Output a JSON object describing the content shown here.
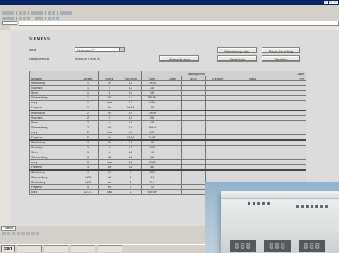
{
  "sheet": {
    "title": "SIEMENS",
    "gerat_label": "Gerät",
    "gerat_value": "Multimeter DO",
    "fabrik_label": "Fabrik Lieferung",
    "fabrik_value": "00000000 0 0000 00",
    "buttons": {
      "messwerte": "Messwerte lesen",
      "balkenanzeige": "Balkenanzeige laden",
      "starte_lesen": "Starte Lesen",
      "display": "Display Darstellung",
      "starte_neu": "Starte Neu"
    },
    "headers": {
      "messwert": "Messwert",
      "anzeige": "Anzeige",
      "einheit": "Einheit",
      "zuordnung": "Zuordnung",
      "wert": "Wert",
      "balkengrenzen": "Balkengrenzen",
      "balken_unten": "Unten",
      "balken_groesse": "größe",
      "balken_grenzwert": "Grenzwert",
      "alarm": "Alarm",
      "alarm_status": "Status",
      "alarm_wert": "Wert"
    },
    "rows": [
      [
        "Wirkleistung",
        "1",
        "W",
        "L1",
        "199,99"
      ],
      [
        "Spannung",
        "1",
        "V",
        "L1",
        "230"
      ],
      [
        "Strom",
        "1",
        "A",
        "L1",
        "180"
      ],
      [
        "Scheinleistung",
        "1",
        "VA",
        "L1",
        "180 MA"
      ],
      [
        "cos φ",
        "1",
        "cosφ",
        "L1",
        "0,99"
      ],
      [
        "Frequenz",
        "1",
        "Hz",
        "L1-L2",
        "50"
      ],
      [
        "Wirkleistung",
        "2",
        "W",
        "L2",
        "199,99"
      ],
      [
        "Spannung",
        "2",
        "V",
        "L2",
        "230"
      ],
      [
        "Strom",
        "2",
        "A",
        "L2",
        "180"
      ],
      [
        "Scheinleistung",
        "2",
        "VA",
        "L2",
        "180MA"
      ],
      [
        "cos φ",
        "2",
        "cosφ",
        "L2",
        "0,99"
      ],
      [
        "Frequenz",
        "2",
        "Hz",
        "L2-L3",
        "0,987"
      ],
      [
        "Wirkleistung",
        "3",
        "W",
        "L3",
        "99"
      ],
      [
        "Spannung",
        "3",
        "V",
        "L3",
        "1007"
      ],
      [
        "Strom",
        "3",
        "A",
        "L3",
        "90"
      ],
      [
        "Scheinleistung",
        "3",
        "VA",
        "L3",
        "180"
      ],
      [
        "cos φ",
        "3",
        "cosφ",
        "L3",
        "97,80"
      ],
      [
        "Frequenz",
        "3",
        "Hz",
        "L3",
        "480"
      ],
      [
        "Wirkleistung",
        "4",
        "W",
        "Σ",
        "2000"
      ],
      [
        "Scheinleistung",
        "1,2,3",
        "VA",
        "Σ",
        "1,1"
      ],
      [
        "Blindleistung",
        "1,2,3",
        "var",
        "Σ",
        "97,1"
      ],
      [
        "Frequenz",
        "4",
        "Hz",
        "Σ",
        "50"
      ],
      [
        "cos φ",
        "1,2,3,4",
        "cosφ",
        "Σ",
        "999,999"
      ]
    ],
    "lcd": [
      "888",
      "888",
      "888"
    ]
  },
  "status": {
    "tab": "Tabelle1",
    "taskbar_start": "Start"
  }
}
